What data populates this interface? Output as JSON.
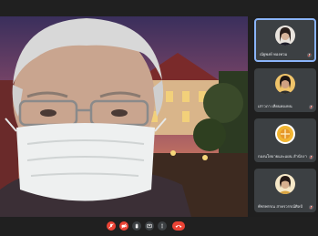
{
  "participants": [
    {
      "name": "ณัฐพงษ์ ทองทวม",
      "active": true,
      "avatar": "woman-portrait"
    },
    {
      "name": "เสาวภา เทียนทองหน",
      "active": false,
      "avatar": "woman-portrait-2"
    },
    {
      "name": "กองนโยบายและแผน สำนักงานอธิการ...",
      "active": false,
      "avatar": "gold-logo"
    },
    {
      "name": "พัชรพรรณ สาครวรรณ์ศิลป์",
      "active": false,
      "avatar": "woman-portrait-3"
    }
  ],
  "controls": [
    {
      "icon": "mic-off-icon",
      "style": "red"
    },
    {
      "icon": "camera-off-icon",
      "style": "red"
    },
    {
      "icon": "raise-hand-icon",
      "style": "dark"
    },
    {
      "icon": "present-icon",
      "style": "dark"
    },
    {
      "icon": "more-icon",
      "style": "dark"
    },
    {
      "icon": "leave-call-icon",
      "style": "red"
    }
  ],
  "colors": {
    "accent": "#8ab4f8",
    "danger": "#ea4335",
    "bar": "#202020",
    "tile": "#3c4043"
  }
}
